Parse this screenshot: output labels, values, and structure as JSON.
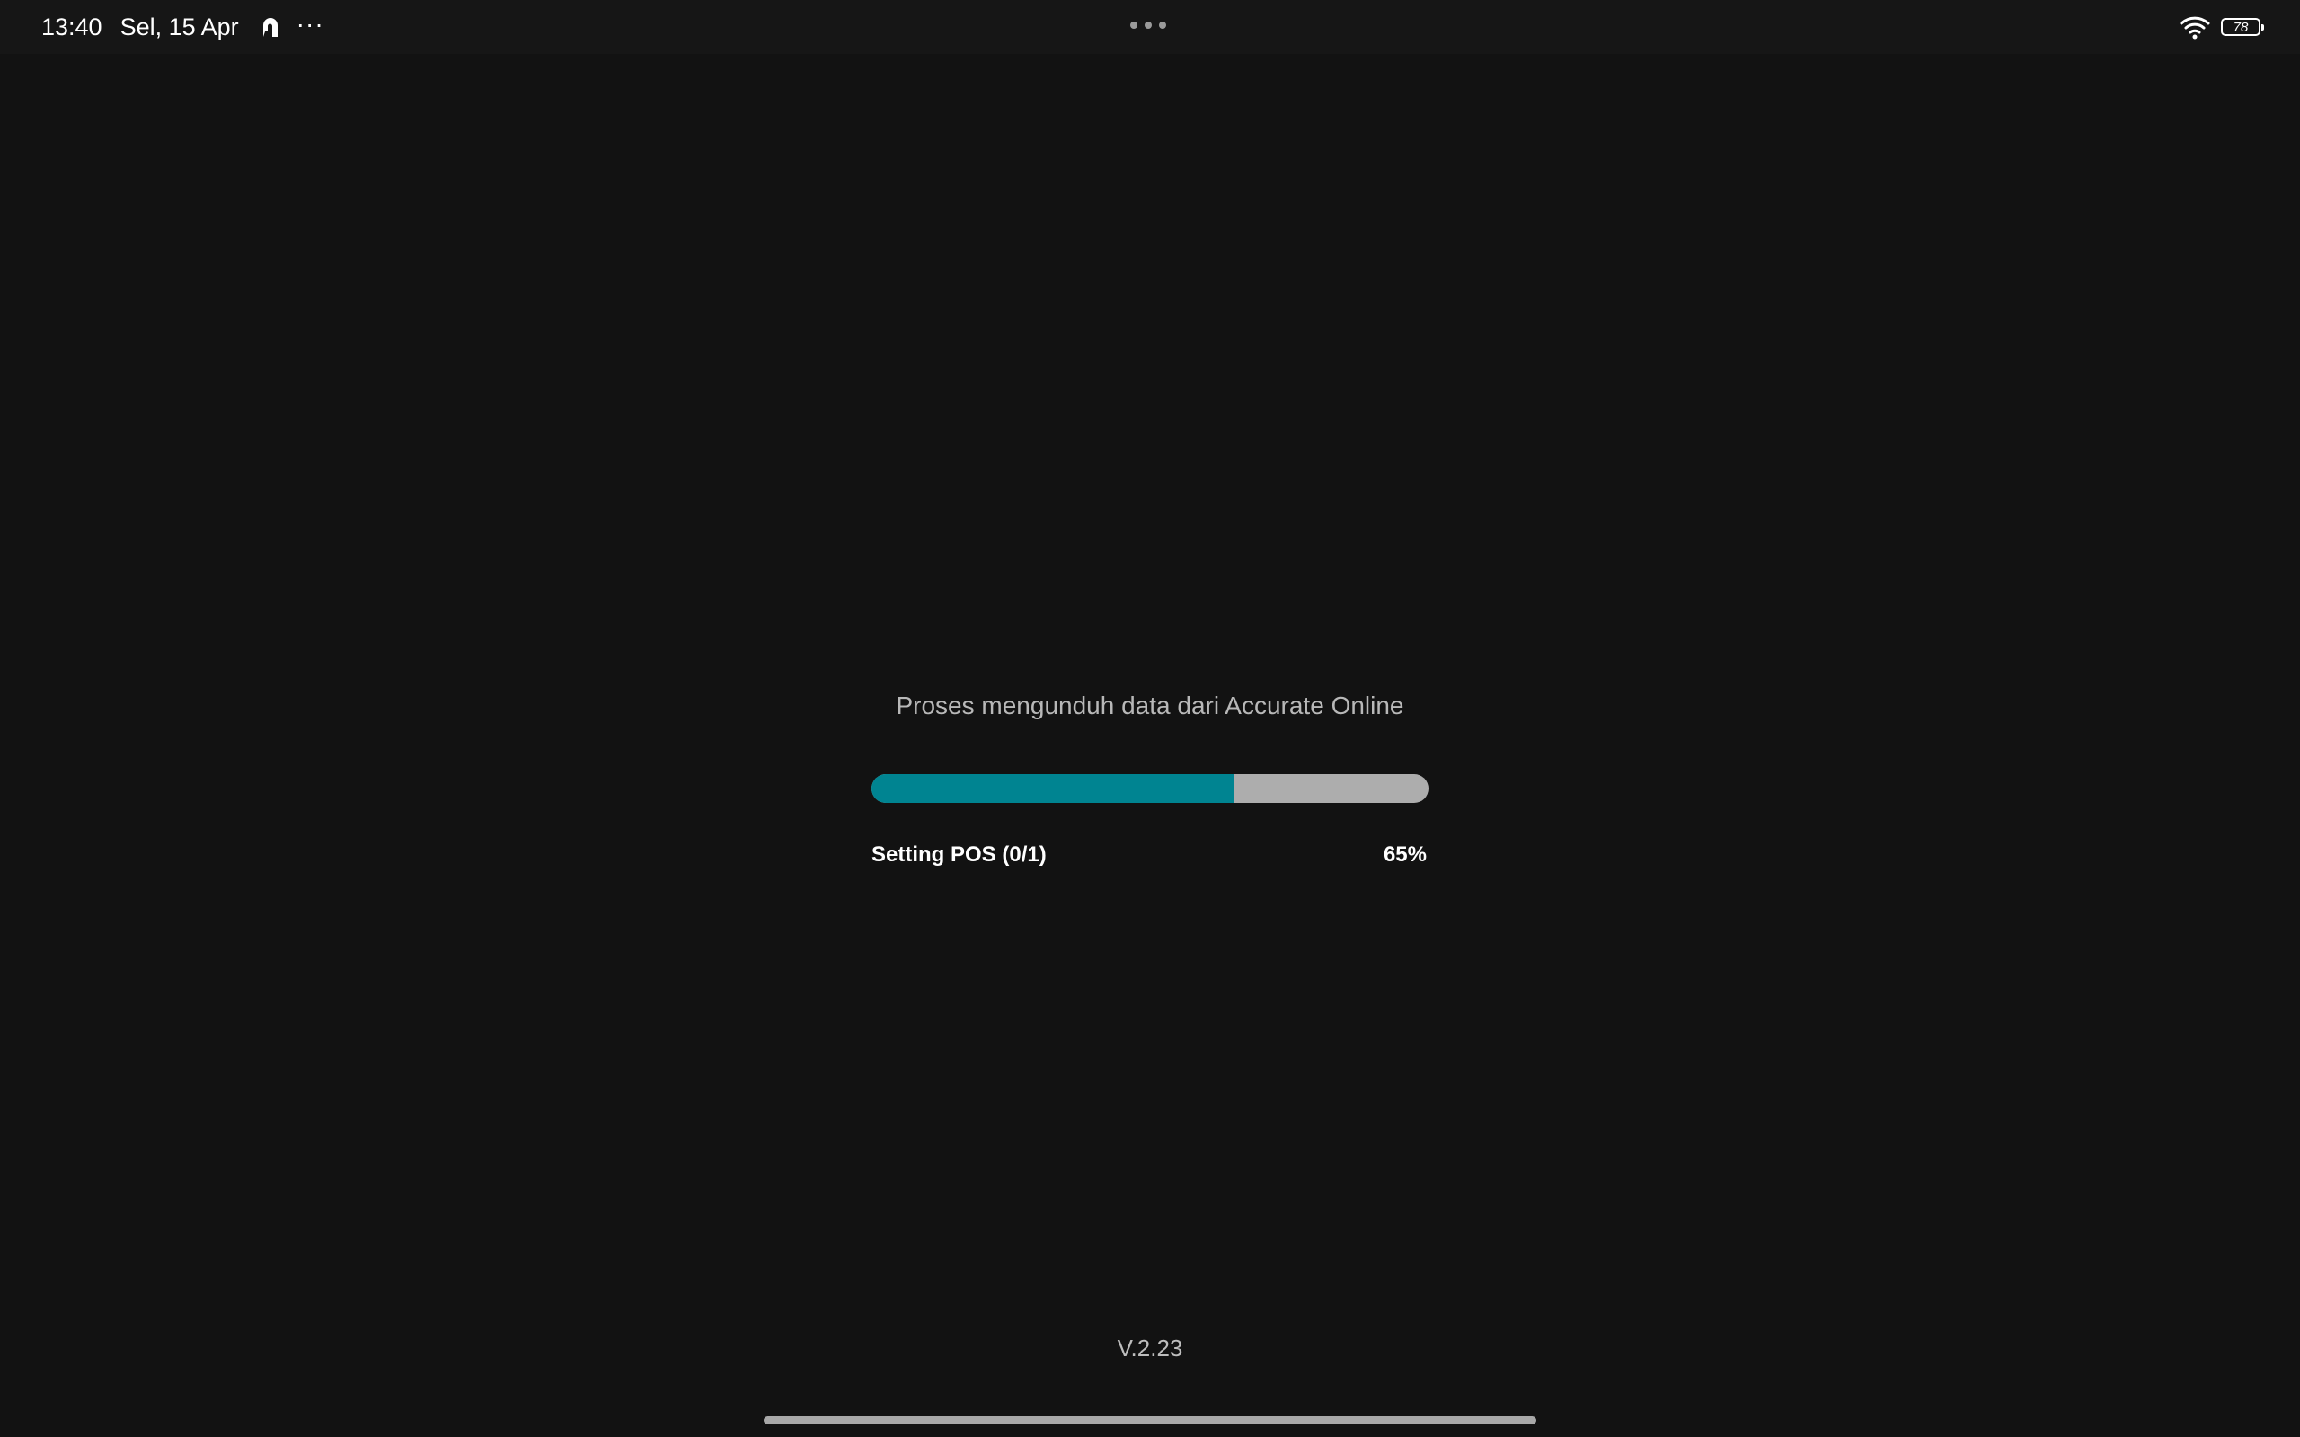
{
  "status_bar": {
    "time": "13:40",
    "date": "Sel, 15 Apr",
    "more": "···",
    "battery_level": "78",
    "icons": [
      "app-notification-icon",
      "wifi-icon",
      "battery-icon"
    ]
  },
  "loader": {
    "title": "Proses mengunduh data dari Accurate Online",
    "step_label": "Setting POS (0/1)",
    "percent_label": "65%",
    "progress": 0.65,
    "fill_color": "#008491",
    "track_color": "#adadad"
  },
  "footer": {
    "version": "V.2.23"
  }
}
